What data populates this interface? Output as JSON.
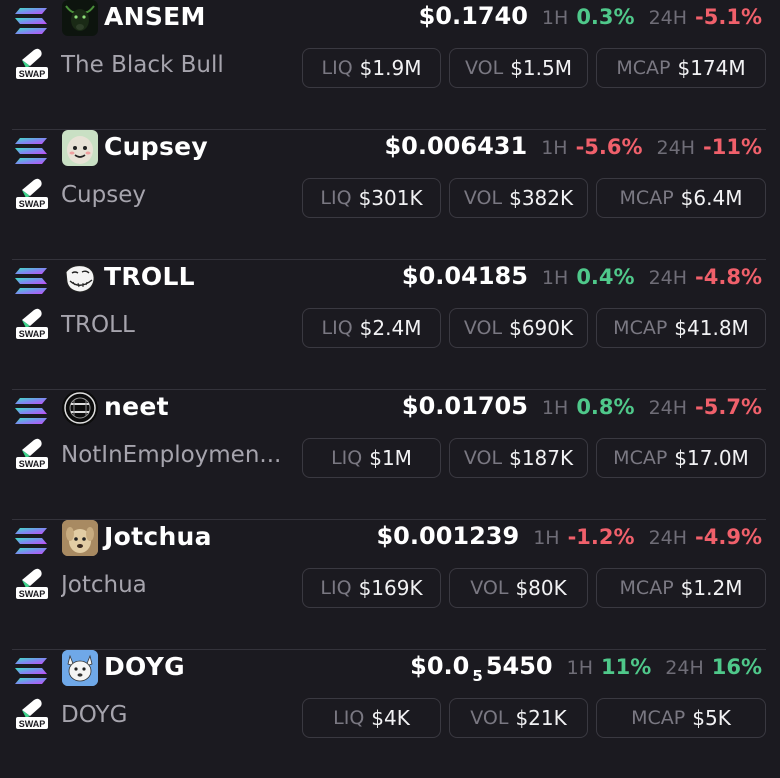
{
  "labels": {
    "h1": "1H",
    "h24": "24H",
    "liq": "LIQ",
    "vol": "VOL",
    "mcap": "MCAP",
    "swap": "SWAP"
  },
  "colors": {
    "positive": "#4fc88a",
    "negative": "#f0606b",
    "background": "#1b1a20"
  },
  "tokens": [
    {
      "symbol": "ANSEM",
      "name": "The Black Bull",
      "avatar": "black-bull-avatar",
      "price": "$0.1740",
      "h1": "0.3%",
      "h1_dir": "pos",
      "h24": "-5.1%",
      "h24_dir": "neg",
      "liq": "$1.9M",
      "vol": "$1.5M",
      "mcap": "$174M"
    },
    {
      "symbol": "Cupsey",
      "name": "Cupsey",
      "avatar": "cupsey-avatar",
      "price": "$0.006431",
      "h1": "-5.6%",
      "h1_dir": "neg",
      "h24": "-11%",
      "h24_dir": "neg",
      "liq": "$301K",
      "vol": "$382K",
      "mcap": "$6.4M"
    },
    {
      "symbol": "TROLL",
      "name": "TROLL",
      "avatar": "trollface-avatar",
      "price": "$0.04185",
      "h1": "0.4%",
      "h1_dir": "pos",
      "h24": "-4.8%",
      "h24_dir": "neg",
      "liq": "$2.4M",
      "vol": "$690K",
      "mcap": "$41.8M"
    },
    {
      "symbol": "neet",
      "name": "NotInEmploymen...",
      "avatar": "neet-avatar",
      "price": "$0.01705",
      "h1": "0.8%",
      "h1_dir": "pos",
      "h24": "-5.7%",
      "h24_dir": "neg",
      "liq": "$1M",
      "vol": "$187K",
      "mcap": "$17.0M"
    },
    {
      "symbol": "Jotchua",
      "name": "Jotchua",
      "avatar": "jotchua-dog-avatar",
      "price": "$0.001239",
      "h1": "-1.2%",
      "h1_dir": "neg",
      "h24": "-4.9%",
      "h24_dir": "neg",
      "liq": "$169K",
      "vol": "$80K",
      "mcap": "$1.2M"
    },
    {
      "symbol": "DOYG",
      "name": "DOYG",
      "avatar": "doyg-avatar",
      "price": "$0.0",
      "price_sub": "5",
      "price_tail": "5450",
      "h1": "11%",
      "h1_dir": "pos",
      "h24": "16%",
      "h24_dir": "pos",
      "liq": "$4K",
      "vol": "$21K",
      "mcap": "$5K"
    }
  ]
}
